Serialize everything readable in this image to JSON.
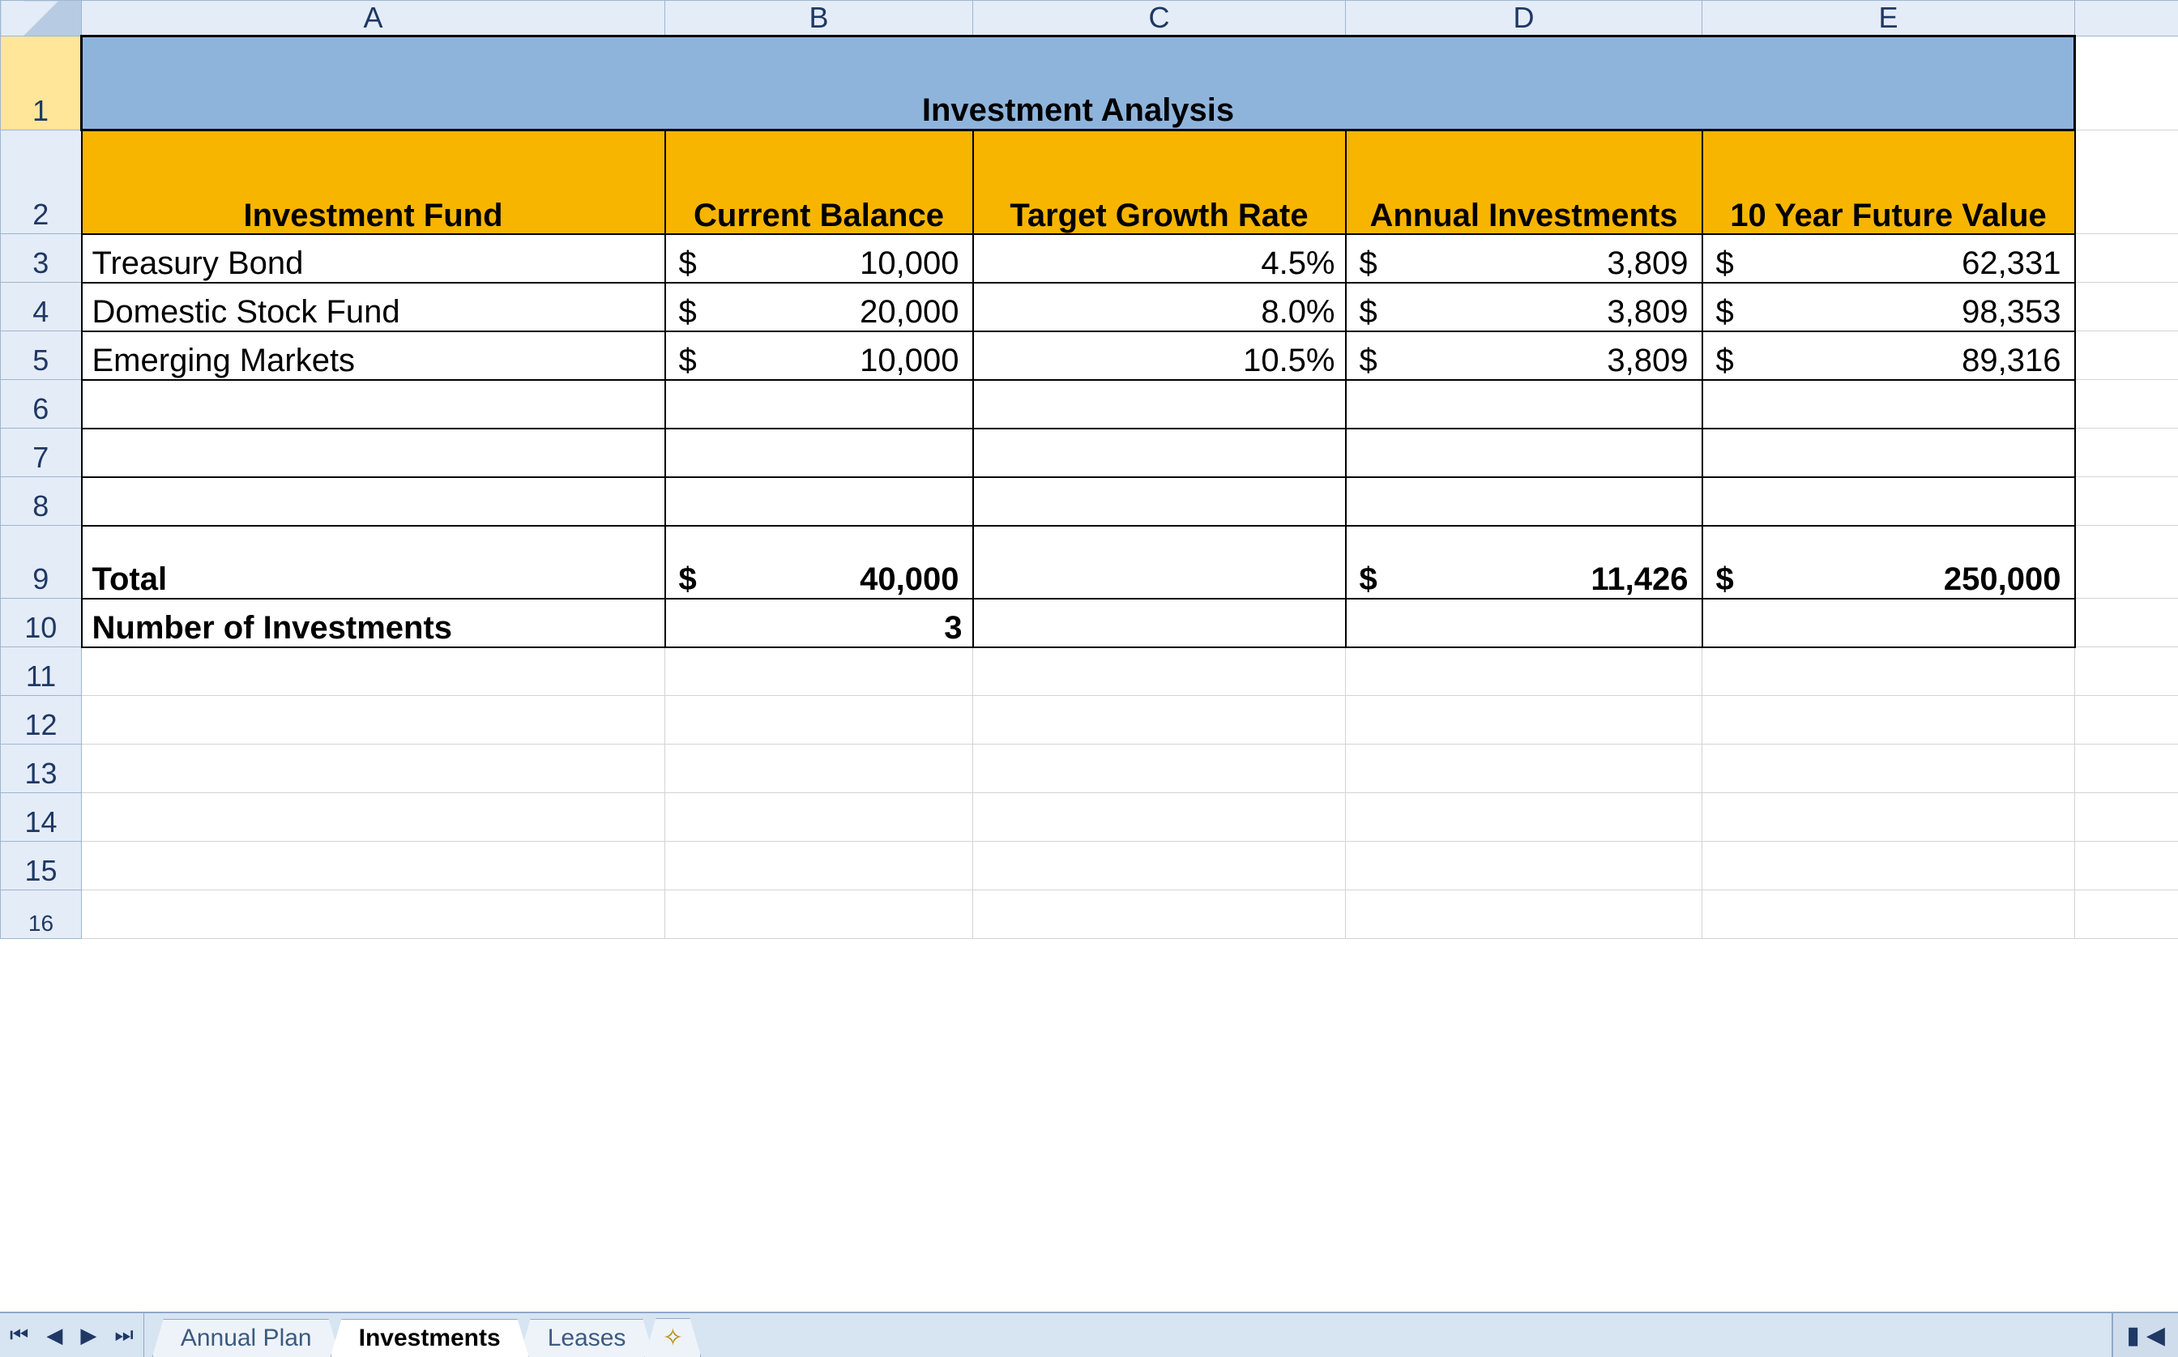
{
  "columns": [
    "A",
    "B",
    "C",
    "D",
    "E"
  ],
  "title": "Investment Analysis",
  "headers": {
    "A": "Investment Fund",
    "B": "Current Balance",
    "C": "Target Growth Rate",
    "D": "Annual Investments",
    "E": "10 Year Future Value"
  },
  "rows": [
    {
      "fund": "Treasury Bond",
      "balance": "10,000",
      "rate": "4.5%",
      "annual": "3,809",
      "future": "62,331"
    },
    {
      "fund": "Domestic Stock Fund",
      "balance": "20,000",
      "rate": "8.0%",
      "annual": "3,809",
      "future": "98,353"
    },
    {
      "fund": "Emerging Markets",
      "balance": "10,000",
      "rate": "10.5%",
      "annual": "3,809",
      "future": "89,316"
    }
  ],
  "total": {
    "label": "Total",
    "balance": "40,000",
    "annual": "11,426",
    "future": "250,000"
  },
  "count": {
    "label": "Number of Investments",
    "value": "3"
  },
  "tabs": {
    "items": [
      "Annual Plan",
      "Investments",
      "Leases"
    ],
    "active": "Investments"
  },
  "currency_symbol": "$"
}
